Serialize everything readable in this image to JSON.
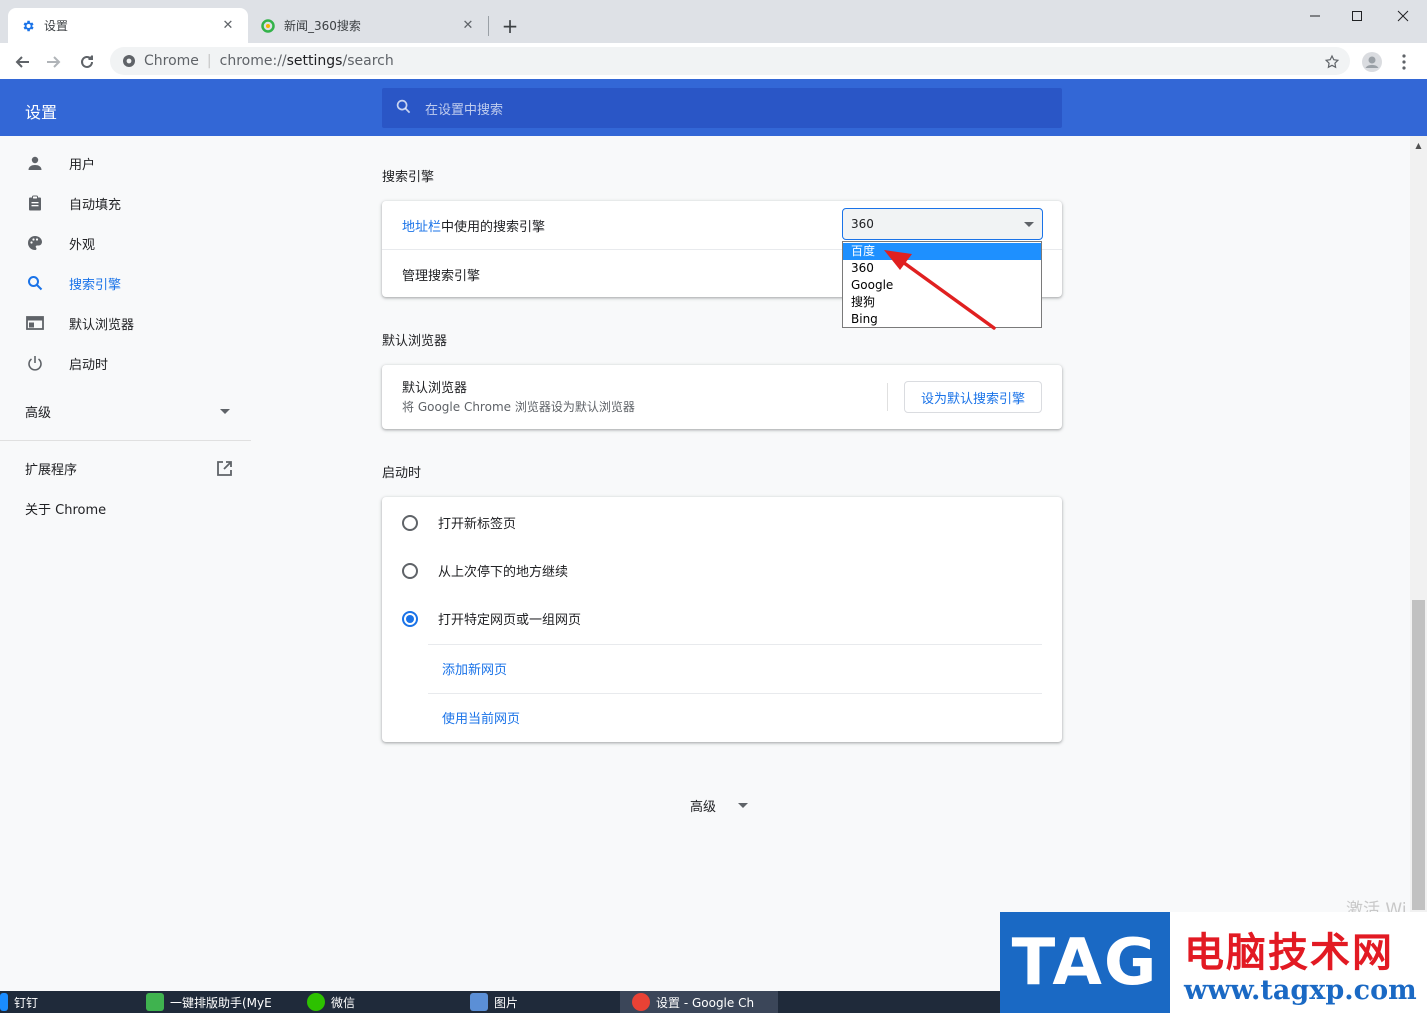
{
  "window": {
    "tabs": [
      {
        "title": "设置",
        "active": true,
        "icon": "gear-icon"
      },
      {
        "title": "新闻_360搜索",
        "active": false,
        "icon": "search-360-icon"
      }
    ]
  },
  "toolbar": {
    "chip": "Chrome",
    "url_scheme": "chrome://",
    "url_host": "settings",
    "url_path": "/search"
  },
  "header": {
    "title": "设置",
    "search_placeholder": "在设置中搜索"
  },
  "sidebar": {
    "items": [
      {
        "label": "用户",
        "icon": "person-icon"
      },
      {
        "label": "自动填充",
        "icon": "clipboard-icon"
      },
      {
        "label": "外观",
        "icon": "palette-icon"
      },
      {
        "label": "搜索引擎",
        "icon": "search-icon",
        "selected": true
      },
      {
        "label": "默认浏览器",
        "icon": "browser-icon"
      },
      {
        "label": "启动时",
        "icon": "power-icon"
      }
    ],
    "advanced": "高级",
    "extensions": "扩展程序",
    "about": "关于 Chrome"
  },
  "search_engine": {
    "section_title": "搜索引擎",
    "address_bar_link": "地址栏",
    "address_bar_rest": "中使用的搜索引擎",
    "selected_value": "360",
    "options": [
      "百度",
      "360",
      "Google",
      "搜狗",
      "Bing"
    ],
    "highlighted_option": "百度",
    "manage": "管理搜索引擎"
  },
  "default_browser": {
    "section_title": "默认浏览器",
    "title": "默认浏览器",
    "subtitle": "将 Google Chrome 浏览器设为默认浏览器",
    "button": "设为默认搜索引擎"
  },
  "startup": {
    "section_title": "启动时",
    "options": [
      {
        "label": "打开新标签页",
        "checked": false
      },
      {
        "label": "从上次停下的地方继续",
        "checked": false
      },
      {
        "label": "打开特定网页或一组网页",
        "checked": true
      }
    ],
    "add_page": "添加新网页",
    "use_current": "使用当前网页"
  },
  "footer": {
    "advanced": "高级"
  },
  "taskbar": {
    "items": [
      "钉钉",
      "一键排版助手(MyE",
      "微信",
      "图片",
      "设置 - Google Ch"
    ]
  },
  "watermark": {
    "activate_text": "激活 Wi",
    "logo_tag": "TAG",
    "logo_cn": "电脑技术网",
    "logo_url": "www.tagxp.com"
  },
  "colors": {
    "accent": "#1a73e8",
    "header_blue": "#3367d6",
    "dropdown_highlight": "#1e90ff",
    "arrow_red": "#e02020"
  }
}
